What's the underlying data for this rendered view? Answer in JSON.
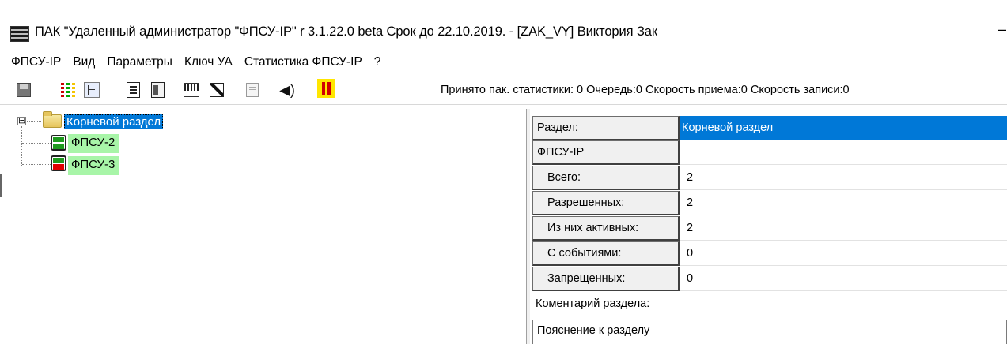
{
  "window": {
    "title": "ПАК \"Удаленный администратор \"ФПСУ-IP\" r 3.1.22.0 beta  Срок до 22.10.2019. - [ZAK_VY] Виктория Зак",
    "minimize_glyph": "–",
    "app_icon": "server-rack-icon"
  },
  "menu": [
    "ФПСУ-IP",
    "Вид",
    "Параметры",
    "Ключ УА",
    "Статистика ФПСУ-IP",
    "?"
  ],
  "toolbar": {
    "icons": [
      "save-icon",
      "grid-view-icon",
      "tree-view-icon",
      "document-icon",
      "document-split-icon",
      "config-icon",
      "pad-icon",
      "list-icon",
      "speaker-icon",
      "stop-icon"
    ],
    "status": "Принято пак. статистики: 0 Очередь:0 Скорость приема:0 Скорость записи:0"
  },
  "tree": {
    "expander": "⊟",
    "root": "Корневой раздел",
    "nodes": [
      {
        "label": "ФПСУ-2",
        "indicator": "#1e9a1e"
      },
      {
        "label": "ФПСУ-3",
        "indicator": "#e00000"
      }
    ]
  },
  "props": {
    "rows": [
      {
        "key": "Раздел:",
        "value": "Корневой раздел"
      },
      {
        "key": "ФПСУ-IP",
        "value": ""
      },
      {
        "key": "Всего:",
        "value": "2"
      },
      {
        "key": "Разрешенных:",
        "value": "2"
      },
      {
        "key": "Из них активных:",
        "value": "2"
      },
      {
        "key": "С событиями:",
        "value": "0"
      },
      {
        "key": "Запрещенных:",
        "value": "0"
      }
    ],
    "comment_label": "Коментарий раздела:",
    "comment_text": "Пояснение к разделу"
  },
  "colors": {
    "selection": "#0078d7",
    "node_highlight": "#a8f5a8",
    "status_ok": "#1e9a1e",
    "status_alert": "#e00000",
    "stop_bg": "#ffe600"
  }
}
